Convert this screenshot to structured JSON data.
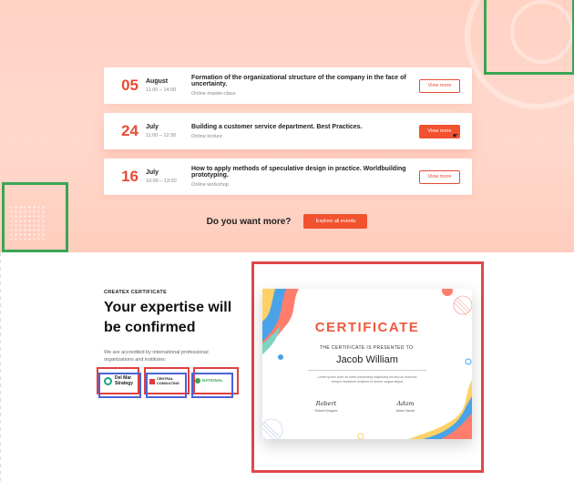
{
  "events": [
    {
      "day": "05",
      "month": "August",
      "time": "11:00 – 14:00",
      "title": "Formation of the organizational structure of the company in the face of uncertainty.",
      "type": "Online master-class",
      "button": "View more",
      "active": false
    },
    {
      "day": "24",
      "month": "July",
      "time": "11:00 – 12:30",
      "title": "Building a customer service department. Best Practices.",
      "type": "Online lecture",
      "button": "View more",
      "active": true
    },
    {
      "day": "16",
      "month": "July",
      "time": "10:00 – 13:00",
      "title": "How to apply methods of speculative design in practice. Worldbuilding prototyping.",
      "type": "Online workshop",
      "button": "View more",
      "active": false
    }
  ],
  "more": {
    "text": "Do you want more?",
    "button": "Explore all events"
  },
  "certificate_section": {
    "eyebrow": "CREATEX CERTIFICATE",
    "headline": "Your expertise will be confirmed",
    "accreditation": "We are accredited by international professional organizations and institutes:",
    "logos": [
      {
        "line1": "Del Mar",
        "line2": "Strategy",
        "color": "#1aa389"
      },
      {
        "line1": "CENTRAL",
        "line2": "CONSULTING",
        "color": "#e0393e"
      },
      {
        "line1": "NATIONAL",
        "line2": "",
        "color": "#3aa655"
      }
    ]
  },
  "certificate": {
    "title": "CERTIFICATE",
    "presented": "THE CERTIFICATE IS PRESENTED TO:",
    "name": "Jacob William",
    "description": "Lorem ipsum dolor sit amet consectetur adipiscing elit sed do eiusmod tempor incididunt ut labore et dolore magna aliqua",
    "signatures": [
      {
        "script": "Robert",
        "role": "Robert Gregoire"
      },
      {
        "script": "Adam",
        "role": "Adam Harold"
      }
    ]
  },
  "colors": {
    "accent": "#f2522f",
    "accent_text": "#e84b37",
    "green_frame": "#3aa655",
    "red_frame": "#e04848",
    "blue_frame": "#4b63d6"
  }
}
